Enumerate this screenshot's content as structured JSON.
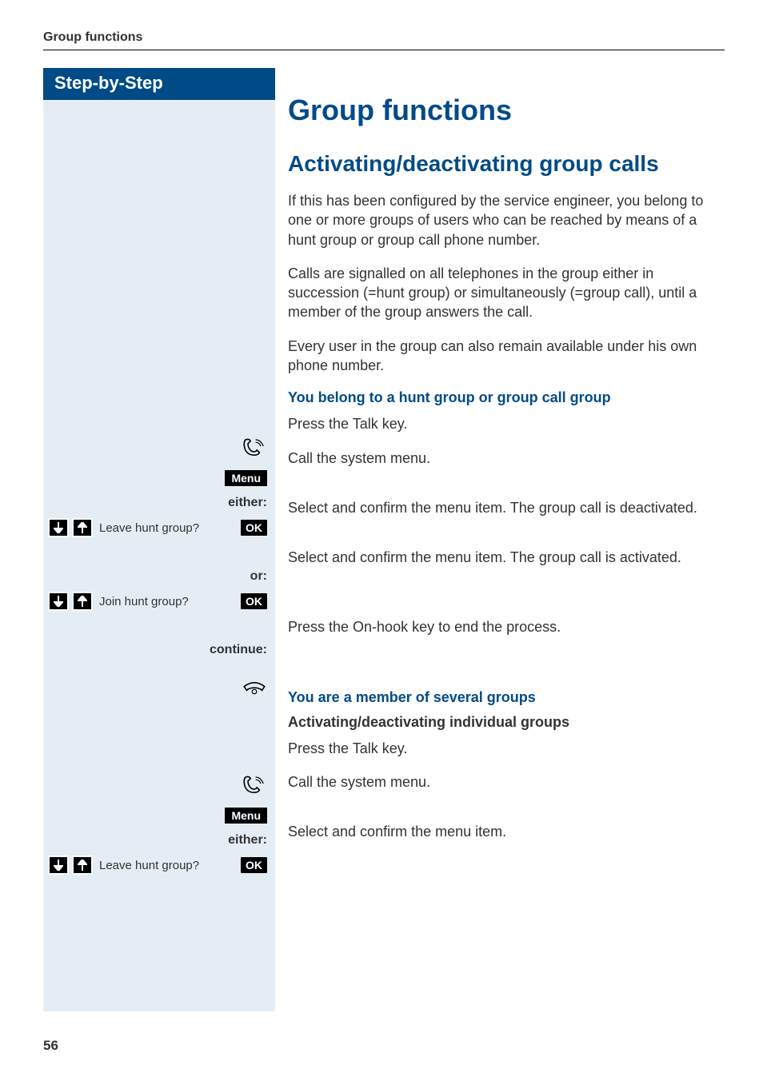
{
  "header": {
    "running_title": "Group functions"
  },
  "sidebar": {
    "title": "Step-by-Step"
  },
  "content": {
    "h1": "Group functions",
    "h2": "Activating/deactivating group calls",
    "p1": "If this has been configured by the service engineer, you belong to one or more groups of users who can be reached by means of a hunt group or group call phone number.",
    "p2": "Calls are signalled on all telephones in the group either in succession (=hunt group) or simultaneously (=group call), until a member of the group answers the call.",
    "p3": "Every user in the group can also remain available under his own phone number.",
    "sub1": "You belong to a hunt group or group call group",
    "sub2": "You are a member of several groups",
    "sub2b": "Activating/deactivating individual groups",
    "press_talk": "Press the Talk key.",
    "call_menu": "Call the system menu.",
    "either": "either:",
    "or": "or:",
    "continue": "continue:",
    "leave_hunt": "Leave hunt group?",
    "join_hunt": "Join hunt group?",
    "menu_badge": "Menu",
    "ok_badge": "OK",
    "leave_text": "Select and confirm the menu item. The group call is deactivated.",
    "join_text": "Select and confirm the menu item. The group call is activated.",
    "onhook_text": "Press the On-hook key to end the process.",
    "select_confirm": "Select and confirm the menu item."
  },
  "page_number": "56"
}
